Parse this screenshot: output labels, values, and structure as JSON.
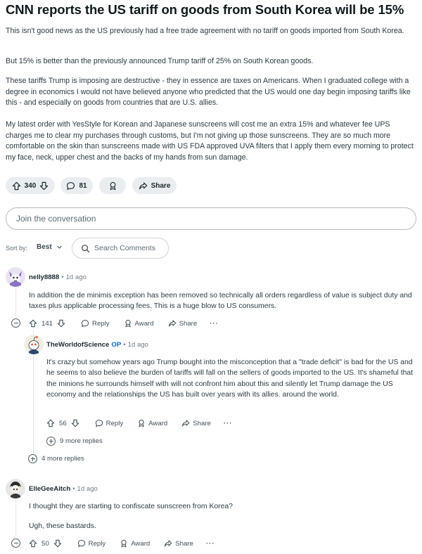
{
  "post": {
    "title": "CNN reports the US tariff on goods from South Korea will be 15%",
    "paragraphs": [
      "This isn't good news as the US previously had a free trade agreement with no tariff on goods imported from South Korea.",
      "But 15% is better than the previously announced Trump tariff of 25% on South Korean goods.",
      "These tariffs Trump is imposing are destructive - they in essence are taxes on Americans. When I graduated college with a degree in economics I would not have believed anyone who predicted that the US would one day begin imposing tariffs like this - and especially on goods from countries that are U.S. allies.",
      "My latest order with YesStyle for Korean and Japanese sunscreens will cost me an extra 15% and whatever fee UPS charges me to clear my purchases through customs, but I'm not giving up those sunscreens. They are so much more comfortable on the skin than sunscreens made with US FDA approved UVA filters that I apply them every morning to protect my face, neck, upper chest and the backs of my hands from sun damage."
    ],
    "votes": "340",
    "comments": "81",
    "share_label": "Share"
  },
  "join_placeholder": "Join the conversation",
  "sort": {
    "label": "Sort by:",
    "value": "Best",
    "search_placeholder": "Search Comments"
  },
  "comments": [
    {
      "author": "nelly8888",
      "time": "1d ago",
      "text": "In addition the de minimis exception has been removed so technically all orders regardless of value is subject duty and taxes plus applicable processing fees. This is a huge blow to US consumers.",
      "votes": "141",
      "reply_label": "Reply",
      "award_label": "Award",
      "share_label": "Share",
      "more_replies": "4 more replies",
      "reply": {
        "author": "TheWorldofScience",
        "op_label": "OP",
        "time": "1d ago",
        "text": "It's crazy but somehow years ago Trump bought into the misconception that a \"trade deficit\" is bad for the US and he seems to also believe the burden of tariffs will fall on the sellers of goods imported to the US. It's shameful that the minions he surrounds himself with will not confront him about this and silently let Trump damage the US economy and the relationships the US has built over years with its allies. around the world.",
        "votes": "56",
        "reply_label": "Reply",
        "award_label": "Award",
        "share_label": "Share",
        "more_replies": "9 more replies"
      }
    },
    {
      "author": "ElleGeeAitch",
      "time": "1d ago",
      "text1": "I thought they are starting to confiscate sunscreen from Korea?",
      "text2": "Ugh, these bastards.",
      "votes": "50",
      "reply_label": "Reply",
      "award_label": "Award",
      "share_label": "Share"
    }
  ],
  "icons": {
    "upvote": "arrow-up-icon",
    "downvote": "arrow-down-icon",
    "comment": "speech-bubble-icon",
    "award": "award-ribbon-icon",
    "share": "share-arrow-icon",
    "more": "ellipsis-icon",
    "search": "search-icon",
    "collapse": "minus-circle-icon",
    "expand": "plus-circle-icon"
  },
  "colors": {
    "text": "#2a3c42",
    "pill_bg": "#eaedef",
    "op_blue": "#0a66d8",
    "thread": "#dfe3e5"
  }
}
